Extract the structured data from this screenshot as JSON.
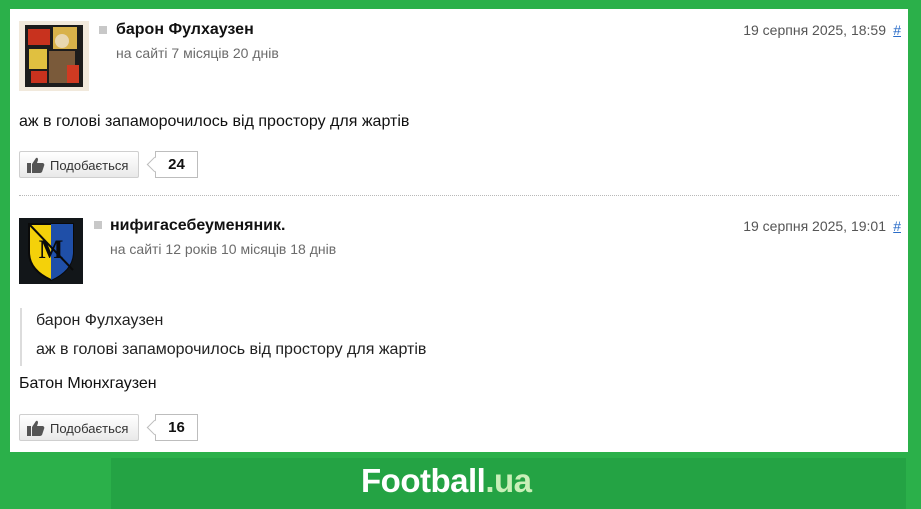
{
  "like_label": "Подобається",
  "comments": [
    {
      "author": "барон Фулхаузен",
      "member_since": "на сайті 7 місяців 20 днів",
      "date": "19 серпня 2025, 18:59",
      "anchor": "#",
      "text": "аж в голові запаморочилось від простору для жартів",
      "likes": "24"
    },
    {
      "author": "нифигасебеуменяник.",
      "member_since": "на сайті 12 років 10 місяців 18 днів",
      "date": "19 серпня 2025, 19:01",
      "anchor": "#",
      "quote": {
        "author": "барон Фулхаузен",
        "text": "аж в голові запаморочилось від простору для жартів"
      },
      "text": "Батон Мюнхгаузен",
      "likes": "16"
    }
  ],
  "footer": {
    "brand": "Football",
    "tld": ".ua"
  },
  "colors": {
    "page_green": "#2bb04a",
    "footer_green": "#24a344",
    "link_blue": "#2a6cc8"
  }
}
